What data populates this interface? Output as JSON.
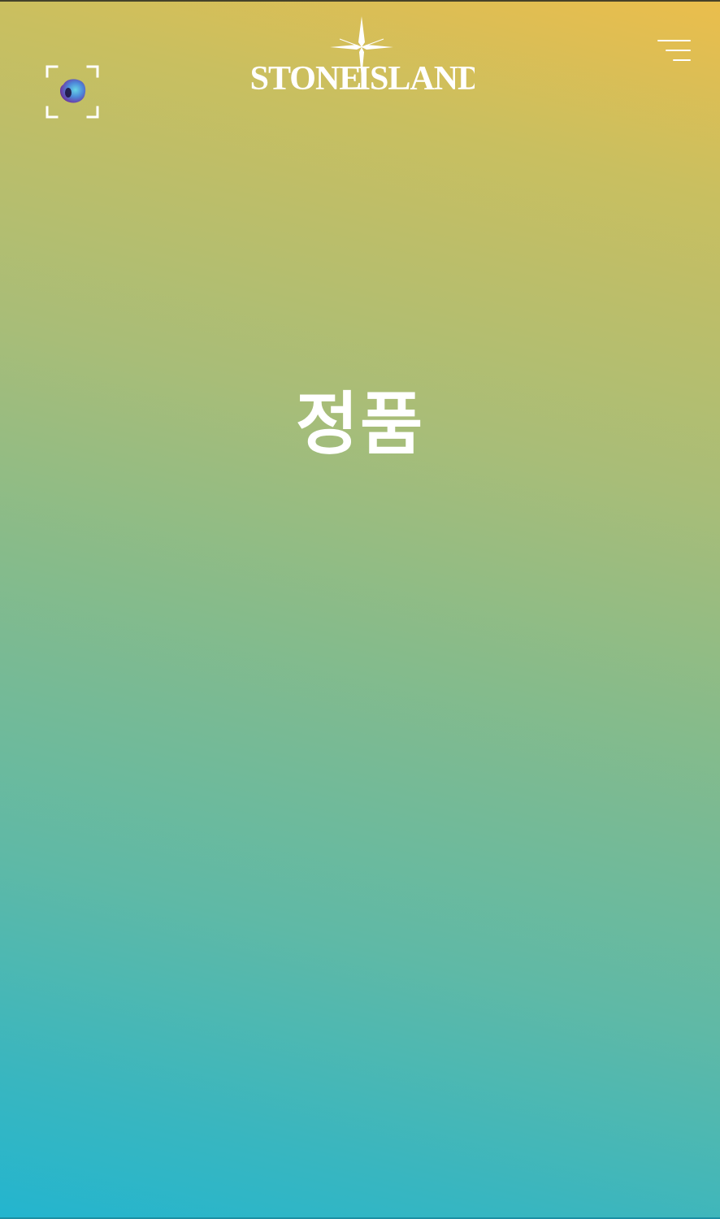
{
  "header": {
    "logo": {
      "text_left": "STONE",
      "text_right": "ISLAND",
      "color": "#ffffff"
    },
    "scan_button": {
      "icon": "ar-scan-icon"
    },
    "menu_button": {
      "icon": "hamburger-menu-icon"
    }
  },
  "main": {
    "headline": "정품"
  },
  "colors": {
    "gradient_top": "#ebbe4c",
    "gradient_mid": "#87bb8a",
    "gradient_bottom": "#23b5cf",
    "text": "#ffffff"
  }
}
